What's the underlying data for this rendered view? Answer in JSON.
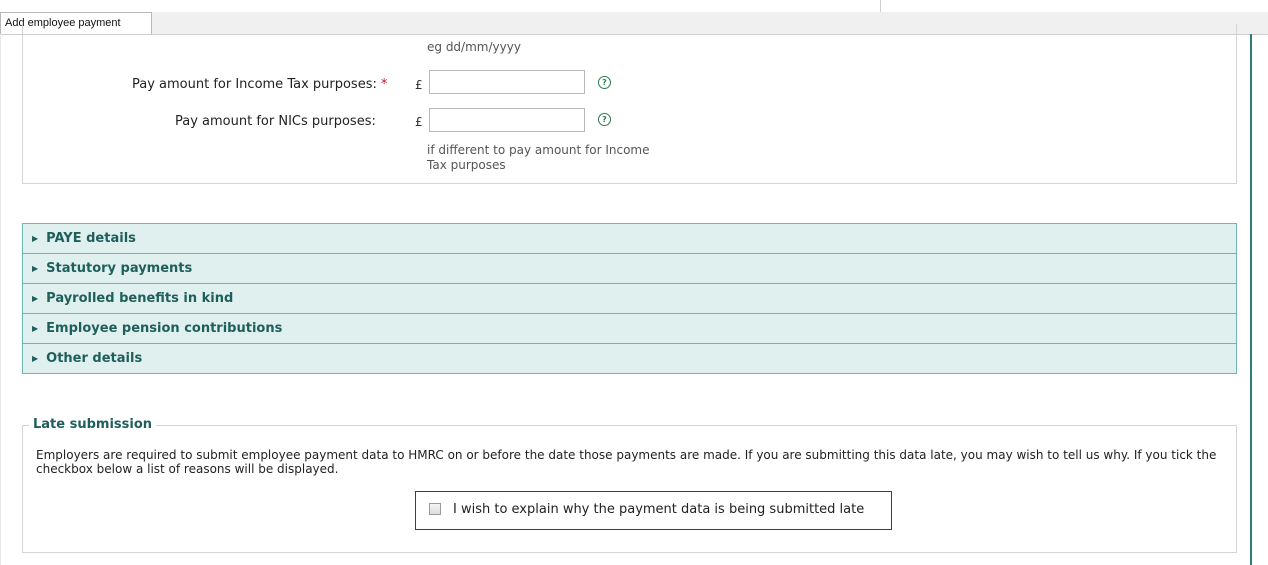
{
  "tab": {
    "label": "Add employee payment"
  },
  "date_hint": "eg dd/mm/yyyy",
  "fields": {
    "income_tax": {
      "label": "Pay amount for Income Tax purposes:",
      "required_mark": "*",
      "currency": "£",
      "value": "",
      "help": "?"
    },
    "nics": {
      "label": "Pay amount for NICs purposes:",
      "currency": "£",
      "value": "",
      "help": "?",
      "hint_line1": "if different to pay amount for Income",
      "hint_line2": "Tax purposes"
    }
  },
  "accordion": [
    {
      "label": "PAYE details"
    },
    {
      "label": "Statutory payments"
    },
    {
      "label": "Payrolled benefits in kind"
    },
    {
      "label": "Employee pension contributions"
    },
    {
      "label": "Other details"
    }
  ],
  "late_submission": {
    "legend": "Late submission",
    "text": "Employers are required to submit employee payment data to HMRC on or before the date those payments are made. If you are submitting this data late, you may wish to tell us why. If you tick the checkbox below a list of reasons will be displayed.",
    "checkbox_label": "I wish to explain why the payment data is being submitted late",
    "checked": false
  },
  "colors": {
    "accent": "#1f5f5b",
    "accordion_bg": "#dff0ef",
    "accordion_border": "#6fb6b2",
    "required": "#c0142c",
    "highlight_border": "#8b1e1e"
  }
}
